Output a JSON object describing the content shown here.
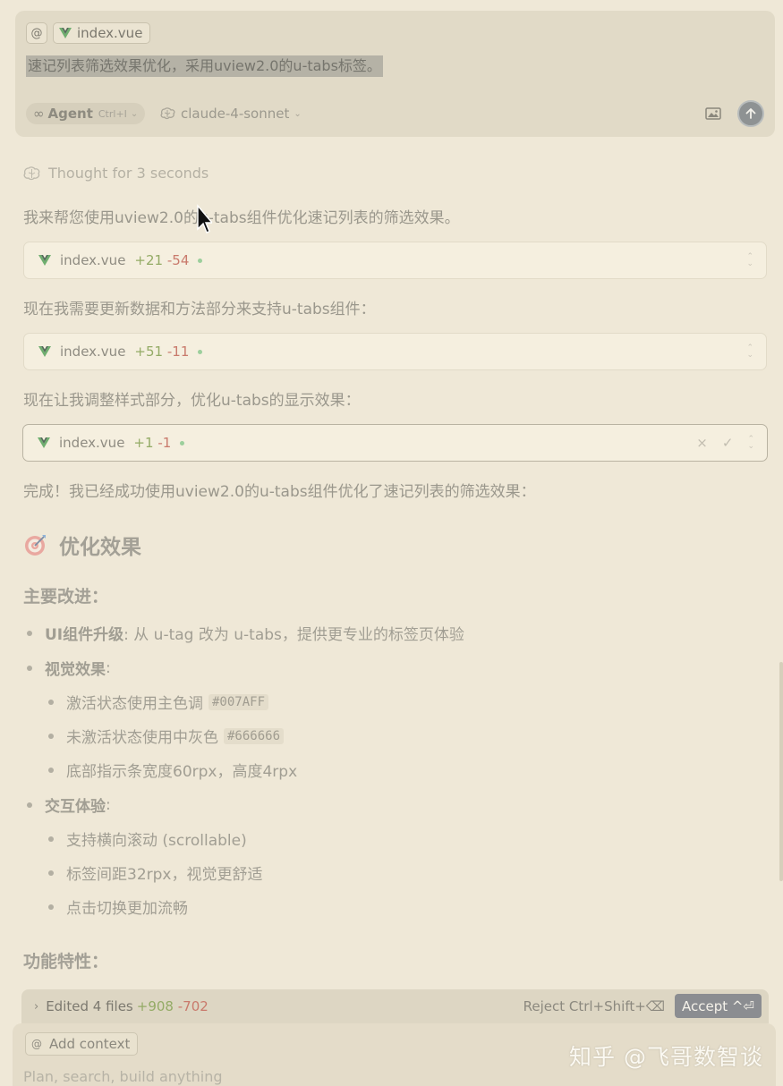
{
  "composer": {
    "at_symbol": "@",
    "context_file": "index.vue",
    "prompt": "速记列表筛选效果优化，采用uview2.0的u-tabs标签。",
    "mode_icon": "∞",
    "mode_label": "Agent",
    "mode_shortcut": "Ctrl+I",
    "model": "claude-4-sonnet",
    "image_icon": "image-icon",
    "send_icon": "arrow-up-icon"
  },
  "conversation": {
    "thought": "Thought for 3 seconds",
    "intro": "我来帮您使用uview2.0的u-tabs组件优化速记列表的筛选效果。",
    "edits": [
      {
        "file": "index.vue",
        "added": "+21",
        "removed": "-54"
      },
      {
        "file": "index.vue",
        "added": "+51",
        "removed": "-11"
      },
      {
        "file": "index.vue",
        "added": "+1",
        "removed": "-1"
      }
    ],
    "step2": "现在我需要更新数据和方法部分来支持u-tabs组件：",
    "step3": "现在让我调整样式部分，优化u-tabs的显示效果：",
    "done": "完成！我已经成功使用uview2.0的u-tabs组件优化了速记列表的筛选效果：",
    "card_close": "×",
    "card_check": "✓"
  },
  "summary": {
    "heading_emoji": "🎯",
    "heading": "优化效果",
    "main_title": "主要改进：",
    "items": {
      "ui_bold": "UI组件升级",
      "ui_text": ": 从 u-tag 改为 u-tabs，提供更专业的标签页体验",
      "visual_bold": "视觉效果",
      "visual_text": ":",
      "visual_1": "激活状态使用主色调",
      "visual_1_code": "#007AFF",
      "visual_2": "未激活状态使用中灰色",
      "visual_2_code": "#666666",
      "visual_3": "底部指示条宽度60rpx，高度4rpx",
      "interact_bold": "交互体验",
      "interact_text": ":",
      "interact_1": "支持横向滚动 (scrollable)",
      "interact_2": "标签间距32rpx，视觉更舒适",
      "interact_3": "点击切换更加流畅"
    },
    "features_title": "功能特性："
  },
  "bottom": {
    "edited_label": "Edited 4 files",
    "edited_added": "+908",
    "edited_removed": "-702",
    "reject": "Reject Ctrl+Shift+⌫",
    "accept": "Accept ^⏎",
    "add_context": "Add context",
    "input_placeholder": "Plan, search, build anything",
    "watermark": "知乎 @飞哥数智谈"
  },
  "colors": {
    "background": "#efe8d7",
    "added": "#94ab66",
    "removed": "#c97a6c",
    "accept_bg": "#8b8d91"
  }
}
